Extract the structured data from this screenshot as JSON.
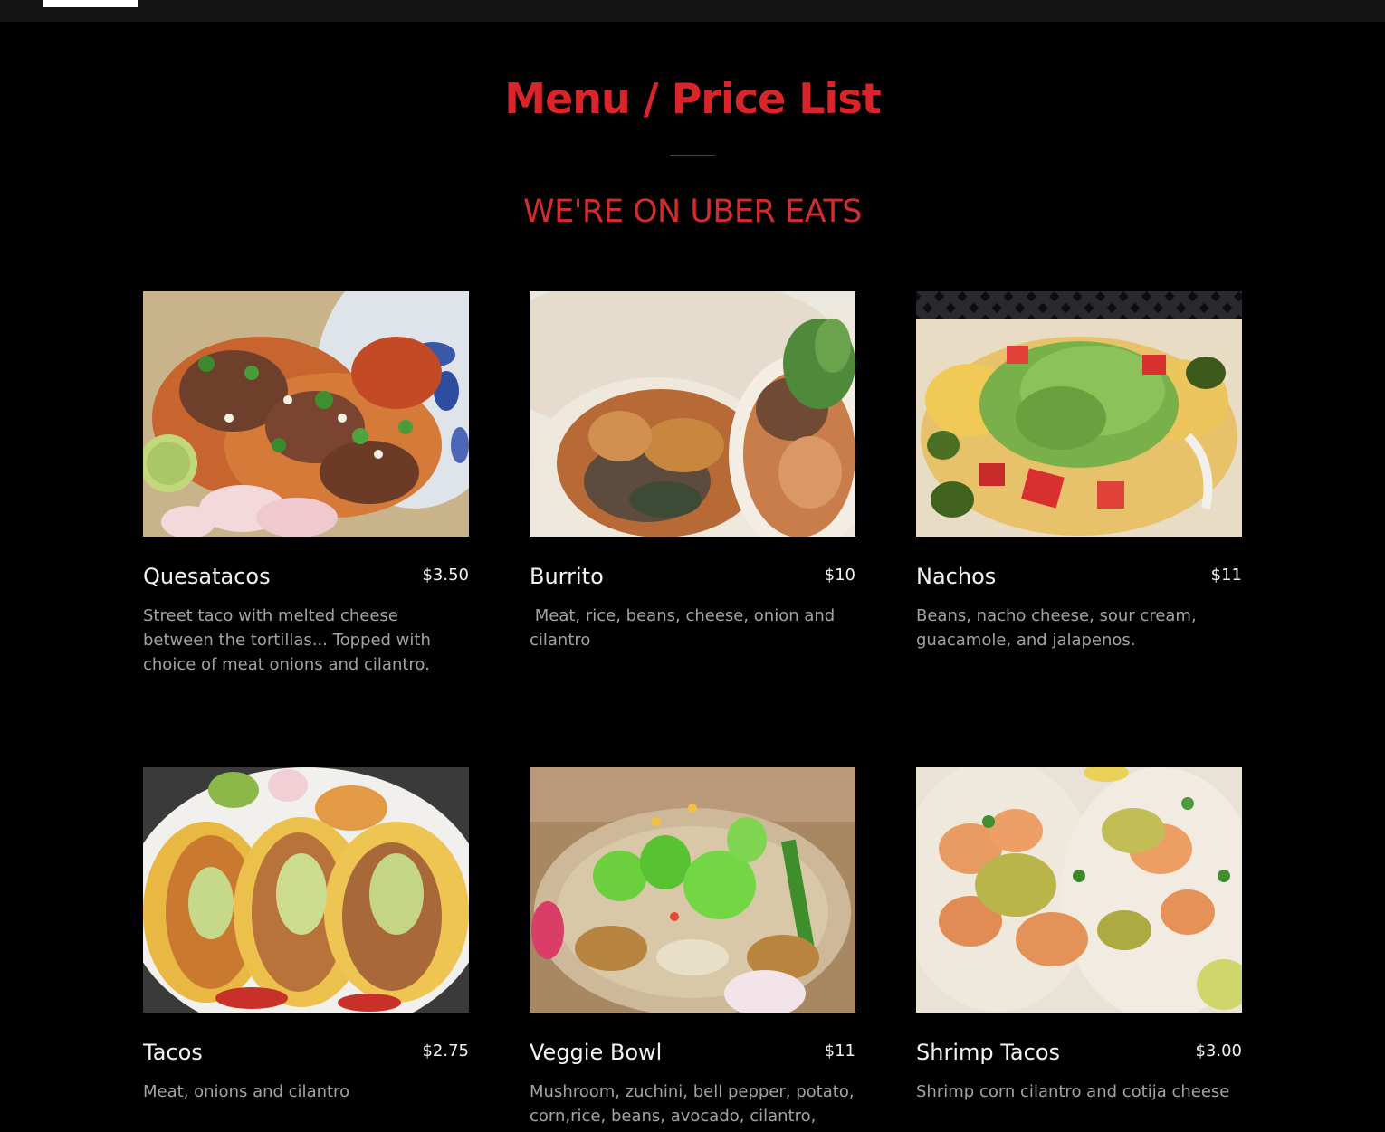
{
  "header": {
    "logo_icon": "logo-block"
  },
  "page": {
    "title": "Menu / Price List",
    "subtitle": "WE'RE ON UBER EATS",
    "colors": {
      "title": "#d9252a",
      "background": "#000000",
      "description": "#a3a3a3"
    }
  },
  "menu": {
    "items": [
      {
        "name": "Quesatacos",
        "price": "$3.50",
        "description": "Street taco with melted cheese between the tortillas... Topped with choice of meat onions and cilantro.",
        "image": "quesatacos-photo"
      },
      {
        "name": "Burrito",
        "price": "$10",
        "description": " Meat, rice, beans, cheese, onion and cilantro",
        "image": "burrito-photo"
      },
      {
        "name": "Nachos",
        "price": "$11",
        "description": "Beans, nacho cheese, sour cream, guacamole, and jalapenos.",
        "image": "nachos-photo"
      },
      {
        "name": "Tacos",
        "price": "$2.75",
        "description": "Meat, onions and cilantro",
        "image": "tacos-photo"
      },
      {
        "name": "Veggie Bowl",
        "price": "$11",
        "description": "Mushroom, zuchini, bell pepper, potato, corn,rice, beans, avocado, cilantro,",
        "image": "veggie-bowl-photo"
      },
      {
        "name": "Shrimp Tacos",
        "price": "$3.00",
        "description": "Shrimp corn cilantro and cotija cheese",
        "image": "shrimp-tacos-photo"
      }
    ]
  }
}
